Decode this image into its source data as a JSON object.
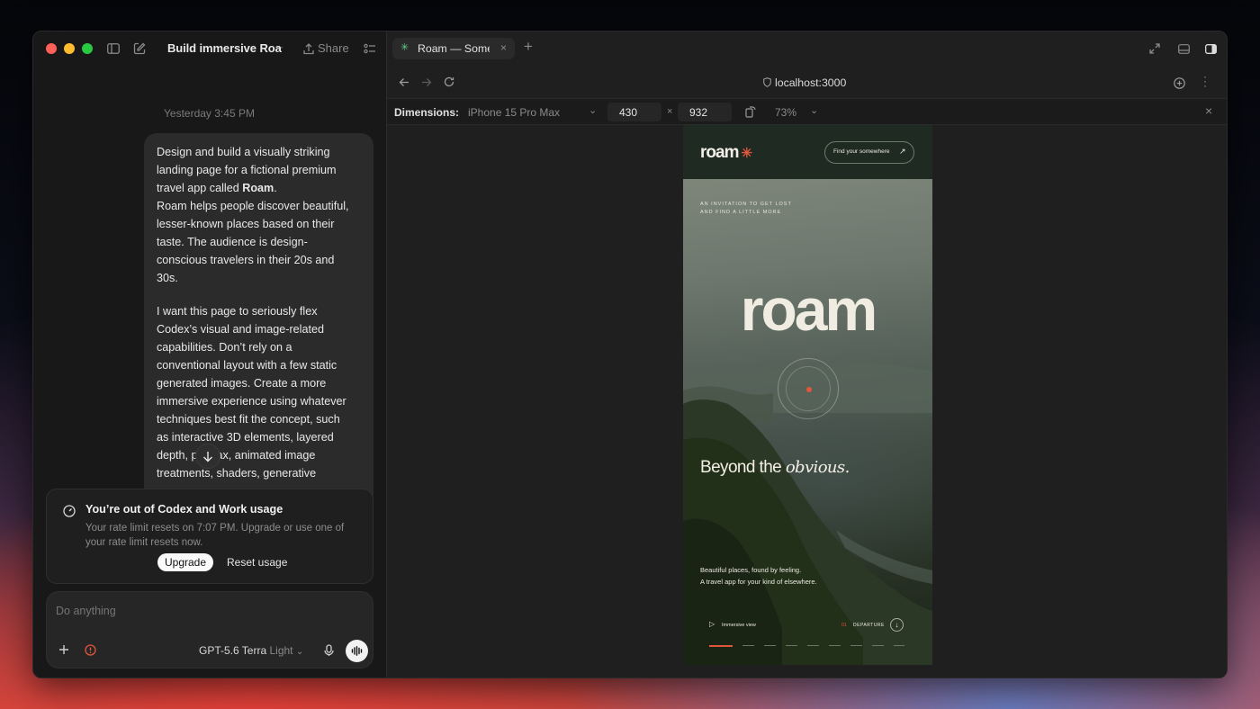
{
  "window": {
    "thread_title": "Build immersive Roa",
    "share_label": "Share"
  },
  "chat": {
    "timestamp": "Yesterday 3:45 PM",
    "message": {
      "p1_a": "Design and build a visually striking",
      "p1_b": "landing page for a fictional premium",
      "p1_c": "travel app called ",
      "p1_c_bold": "Roam",
      "p1_c_end": ".",
      "p2_a": "Roam helps people discover beautiful,",
      "p2_b": "lesser-known places based on their",
      "p2_c": "taste. The audience is design-",
      "p2_d": "conscious travelers in their 20s and",
      "p2_e": "30s.",
      "p3_a": "I want this page to seriously flex",
      "p3_b": "Codex’s visual and image-related",
      "p3_c": "capabilities. Don’t rely on a",
      "p3_d": "conventional layout with a few static",
      "p3_e": "generated images. Create a more",
      "p3_f": "immersive experience using whatever",
      "p3_g": "techniques best fit the concept, such",
      "p3_h": "as interactive 3D elements, layered",
      "p3_i": "depth, p      ax, animated image",
      "p3_j": "treatments, shaders, generative"
    },
    "usage_alert": {
      "title": "You’re out of Codex and Work usage",
      "body_1": "Your rate limit resets on 7:07 PM. Upgrade or use one of",
      "body_2": "your rate limit resets now.",
      "upgrade_label": "Upgrade",
      "reset_label": "Reset usage"
    },
    "composer": {
      "placeholder": "Do anything",
      "model": "GPT-5.6 Terra",
      "mode": "Light"
    }
  },
  "browser": {
    "tab_title": "Roam — Some",
    "url": "localhost:3000",
    "dimensions_label": "Dimensions:",
    "device": "iPhone 15 Pro Max",
    "width": "430",
    "times": "×",
    "height": "932",
    "zoom": "73%"
  },
  "site": {
    "brand": "roam",
    "cta": "Find your somewhere",
    "eyebrow_1": "AN INVITATION TO GET LOST",
    "eyebrow_2": "AND FIND A LITTLE MORE",
    "hero_word": "roam",
    "tagline_a": "Beyond the ",
    "tagline_b": "obvious.",
    "sub_1": "Beautiful places, found by feeling.",
    "sub_2": "A travel app for your kind of elsewhere.",
    "immersive": "Immersive view",
    "index": "01",
    "departure": "DEPARTURE",
    "accent_color": "#e0563b"
  }
}
